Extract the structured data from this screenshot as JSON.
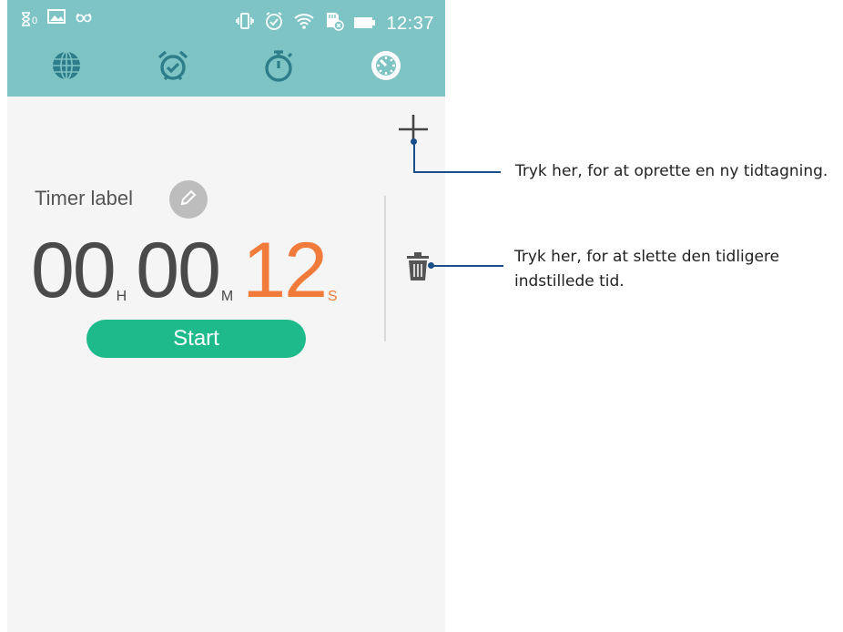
{
  "statusbar": {
    "notification_badge": "0",
    "time": "12:37"
  },
  "tabs": [
    {
      "icon": "globe-icon"
    },
    {
      "icon": "alarm-icon"
    },
    {
      "icon": "stopwatch-icon"
    },
    {
      "icon": "timer-icon",
      "active": true
    }
  ],
  "timer": {
    "label": "Timer label",
    "hours": "00",
    "hours_unit": "H",
    "minutes": "00",
    "minutes_unit": "M",
    "seconds": "12",
    "seconds_unit": "S",
    "start_label": "Start"
  },
  "callouts": {
    "add": "Tryk her, for at oprette en ny tidtagning.",
    "delete_line1": "Tryk her, for at slette den tidligere",
    "delete_line2": "indstillede tid."
  },
  "colors": {
    "header": "#7ec4c4",
    "accent_orange": "#f07b3a",
    "start_button": "#1fba8c",
    "callout_line": "#1b4f8a"
  }
}
